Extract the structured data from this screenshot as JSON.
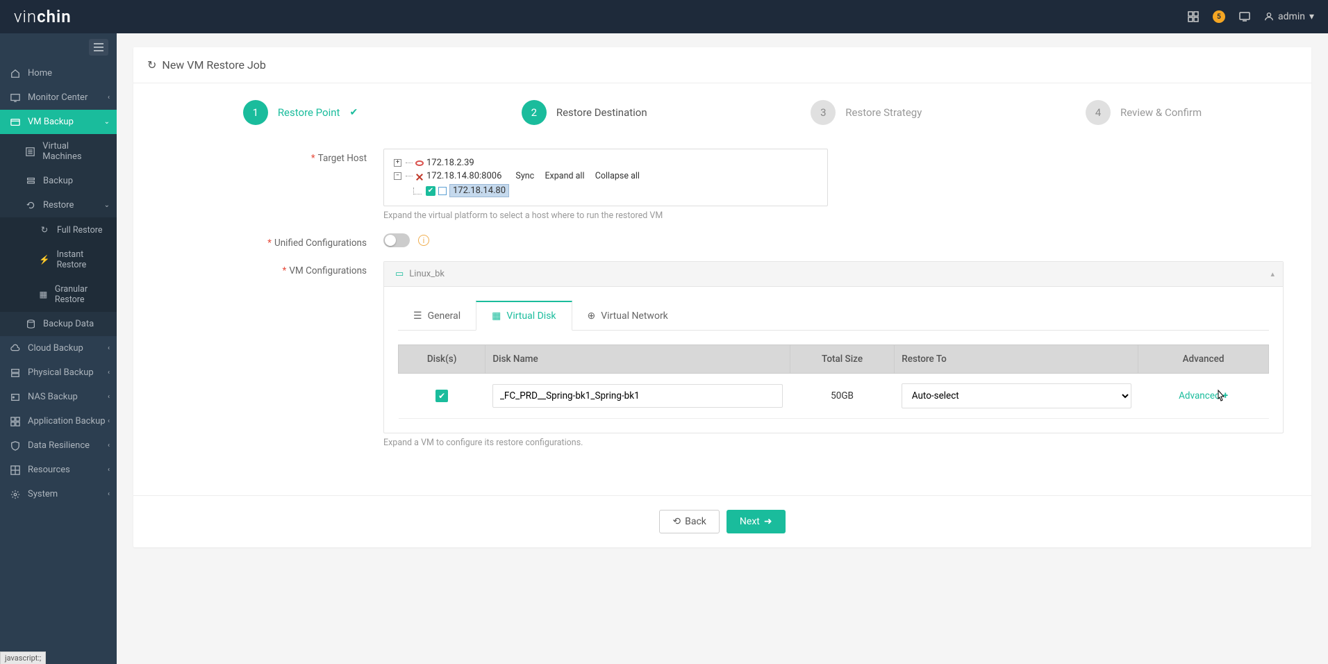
{
  "brand": {
    "part1": "vin",
    "part2": "chin"
  },
  "header": {
    "user": "admin",
    "notif_count": "5"
  },
  "sidebar": {
    "home": "Home",
    "monitor": "Monitor Center",
    "vmbackup": "VM Backup",
    "sub": {
      "vms": "Virtual Machines",
      "backup": "Backup",
      "restore": "Restore",
      "full": "Full Restore",
      "instant": "Instant Restore",
      "granular": "Granular Restore",
      "bdata": "Backup Data"
    },
    "cloud": "Cloud Backup",
    "physical": "Physical Backup",
    "nas": "NAS Backup",
    "app": "Application Backup",
    "dres": "Data Resilience",
    "resources": "Resources",
    "system": "System"
  },
  "page": {
    "title": "New VM Restore Job",
    "steps": {
      "s1": "Restore Point",
      "s2": "Restore Destination",
      "s3": "Restore Strategy",
      "s4": "Review & Confirm"
    },
    "labels": {
      "target_host": "Target Host",
      "unified": "Unified Configurations",
      "vmconf": "VM Configurations"
    },
    "tree": {
      "node1": "172.18.2.39",
      "node2": "172.18.14.80:8006",
      "node2_host": "172.18.14.80",
      "sync": "Sync",
      "expand": "Expand all",
      "collapse": "Collapse all"
    },
    "helpers": {
      "target": "Expand the virtual platform to select a host where to run the restored VM",
      "vmconf": "Expand a VM to configure its restore configurations."
    },
    "vm_name": "Linux_bk",
    "tabs": {
      "general": "General",
      "vdisk": "Virtual Disk",
      "vnet": "Virtual Network"
    },
    "table": {
      "h_disks": "Disk(s)",
      "h_name": "Disk Name",
      "h_size": "Total Size",
      "h_restore": "Restore To",
      "h_adv": "Advanced",
      "row": {
        "name": "_FC_PRD__Spring-bk1_Spring-bk1",
        "size": "50GB",
        "restore_to": "Auto-select",
        "adv": "Advanced"
      }
    },
    "buttons": {
      "back": "Back",
      "next": "Next"
    }
  },
  "status_bar": "javascript:;"
}
